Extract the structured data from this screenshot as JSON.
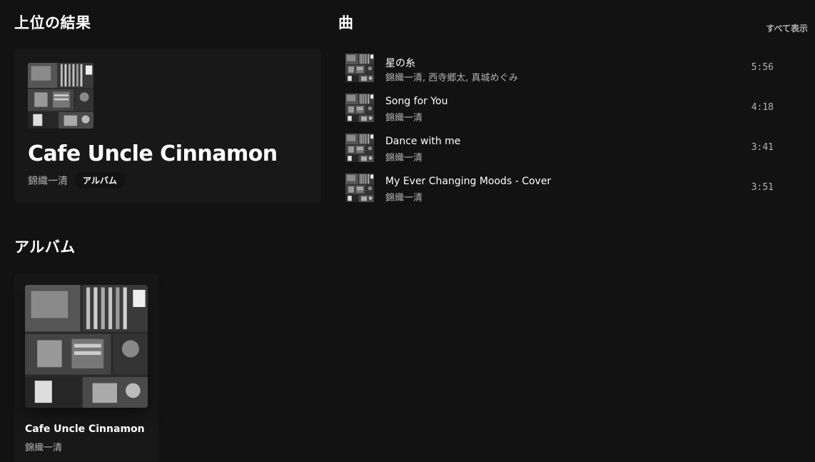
{
  "sections": {
    "top_result_title": "上位の結果",
    "songs_title": "曲",
    "see_all": "すべて表示",
    "albums_title": "アルバム"
  },
  "top_result": {
    "name": "Cafe Uncle Cinnamon",
    "artist": "錦織一清",
    "type_badge": "アルバム",
    "cover": "album-collage-bw"
  },
  "tracks": [
    {
      "title": "星の糸",
      "artists": "錦織一清, 西寺郷太, 真城めぐみ",
      "duration": "5:56"
    },
    {
      "title": "Song for You",
      "artists": "錦織一清",
      "duration": "4:18"
    },
    {
      "title": "Dance with me",
      "artists": "錦織一清",
      "duration": "3:41"
    },
    {
      "title": "My Ever Changing Moods - Cover",
      "artists": "錦織一清",
      "duration": "3:51"
    }
  ],
  "albums": [
    {
      "name": "Cafe Uncle Cinnamon",
      "artist": "錦織一清",
      "cover": "album-collage-bw"
    }
  ],
  "colors": {
    "background": "#121212",
    "card": "#181818",
    "secondary_text": "#b3b3b3"
  }
}
